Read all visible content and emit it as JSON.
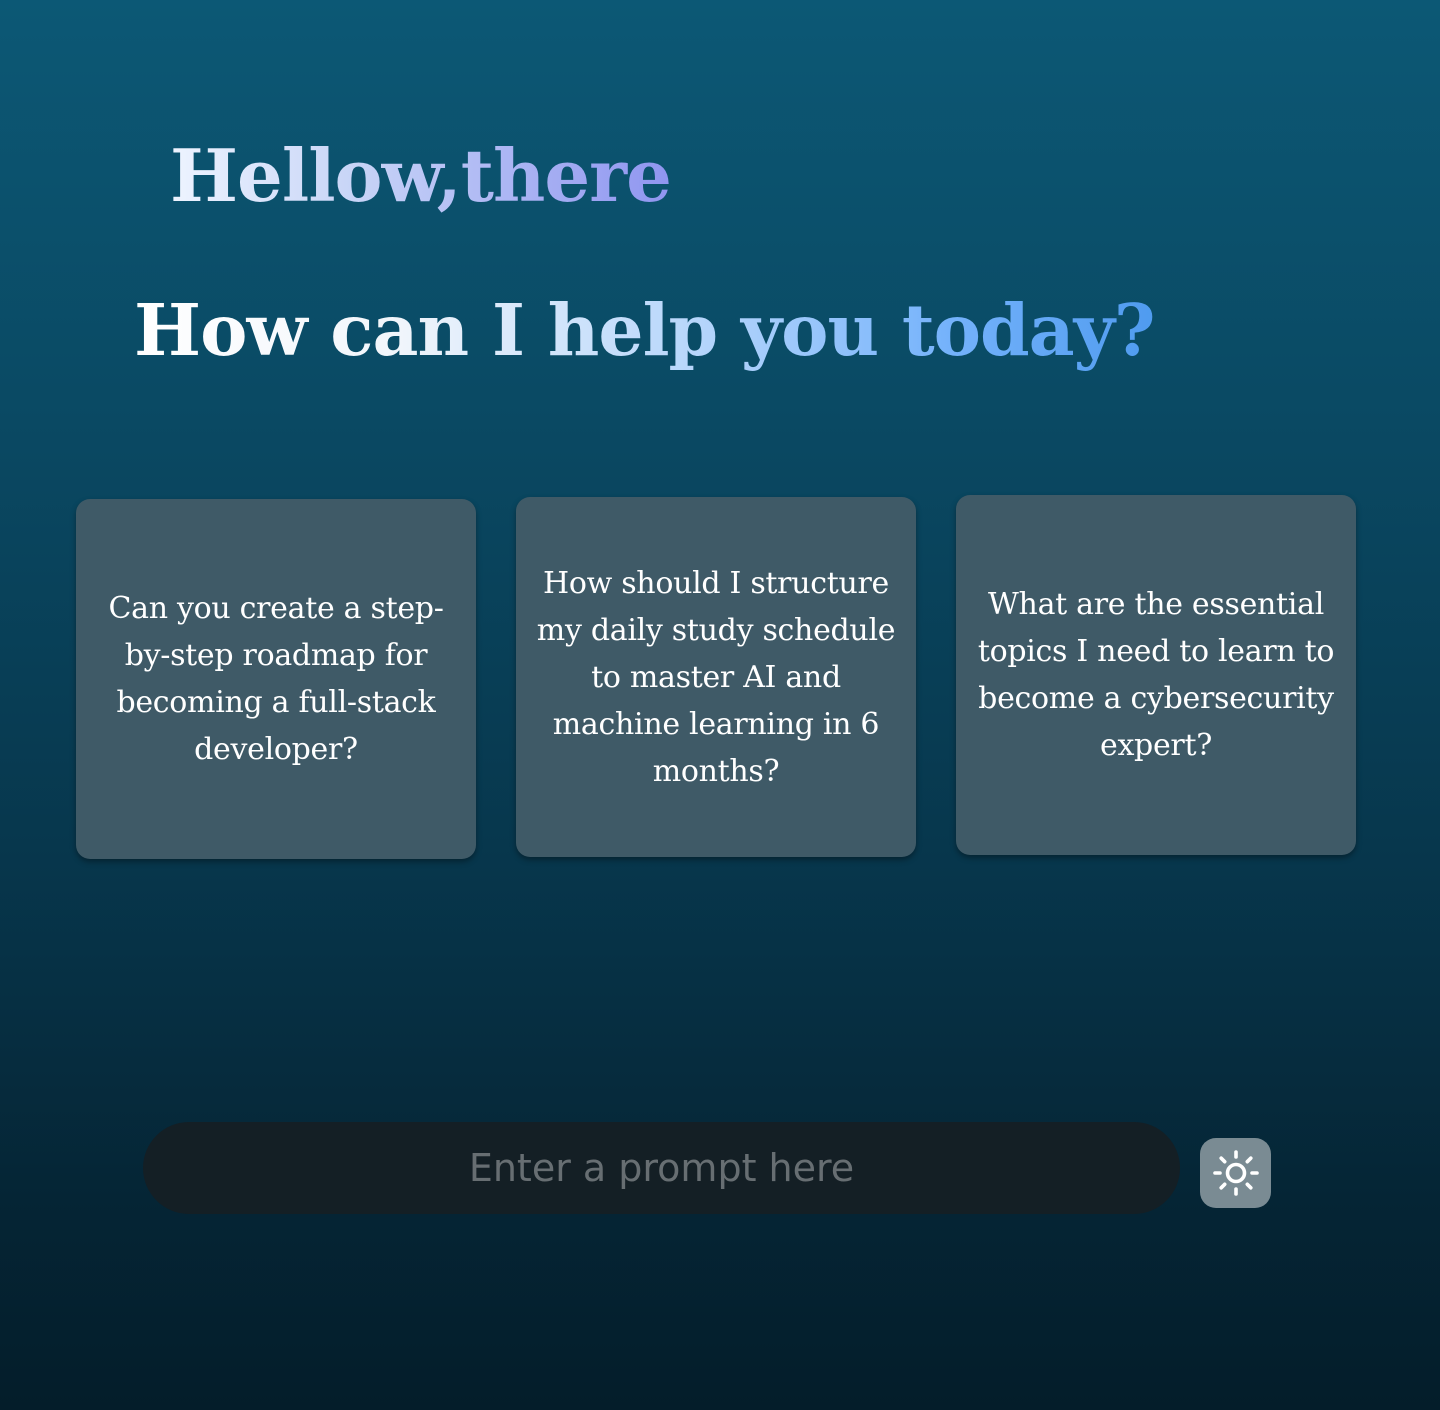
{
  "greeting": "Hellow,there",
  "headline": "How can I help you today?",
  "suggestions": [
    {
      "text": "Can you create a step-by-step roadmap for becoming a full-stack developer?"
    },
    {
      "text": "How should I structure my daily study schedule to master AI and machine learning in 6 months?"
    },
    {
      "text": "What are the essential topics I need to learn to become a cybersecurity expert?"
    }
  ],
  "prompt": {
    "placeholder": "Enter a prompt here",
    "value": ""
  },
  "theme_toggle": {
    "icon": "sun-icon"
  },
  "colors": {
    "background_top": "#0c5875",
    "background_bottom": "#041d2a",
    "card": "#3f5a67",
    "prompt_bar": "#141f25",
    "theme_button": "#7a8b93",
    "headline_accent": "#4f9bef",
    "greeting_accent": "#8f95f0"
  }
}
